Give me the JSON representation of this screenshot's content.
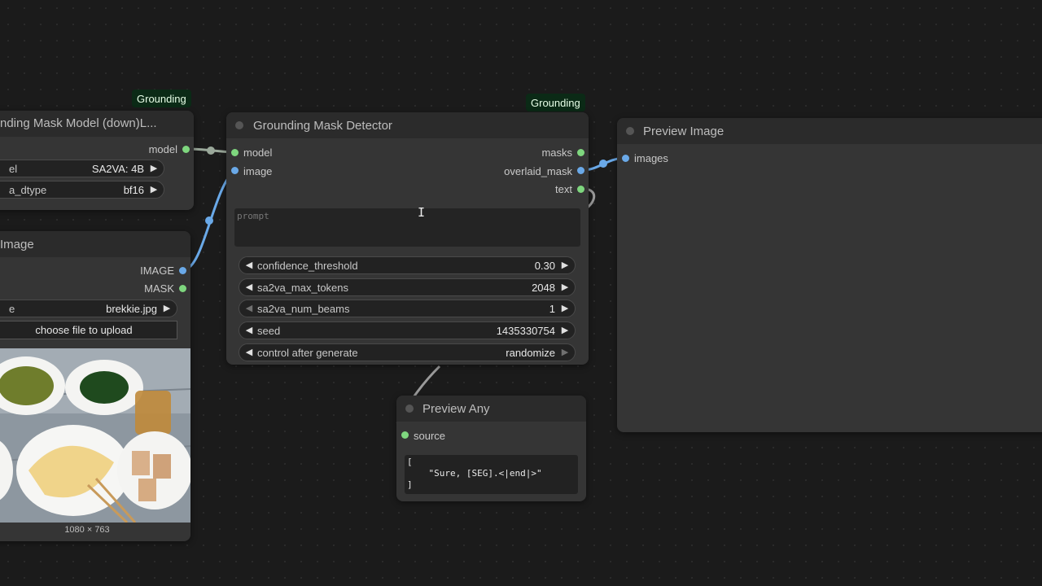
{
  "model_node": {
    "title": "nding Mask Model (down)L...",
    "badge": "Grounding",
    "output_model": "model",
    "widgets": [
      {
        "name": "el",
        "value": "SA2VA: 4B"
      },
      {
        "name": "a_dtype",
        "value": "bf16"
      }
    ]
  },
  "load_image_node": {
    "title": "Image",
    "outputs": [
      "IMAGE",
      "MASK"
    ],
    "file_widget": {
      "name": "e",
      "value": "brekkie.jpg"
    },
    "upload_button": "choose file to upload",
    "image_size": "1080 × 763"
  },
  "detector_node": {
    "title": "Grounding Mask Detector",
    "badge": "Grounding",
    "inputs": [
      "model",
      "image"
    ],
    "outputs": [
      "masks",
      "overlaid_mask",
      "text"
    ],
    "prompt_placeholder": "prompt",
    "widgets": [
      {
        "name": "confidence_threshold",
        "value": "0.30"
      },
      {
        "name": "sa2va_max_tokens",
        "value": "2048"
      },
      {
        "name": "sa2va_num_beams",
        "value": "1"
      },
      {
        "name": "seed",
        "value": "1435330754"
      },
      {
        "name": "control after generate",
        "value": "randomize"
      }
    ]
  },
  "preview_image_node": {
    "title": "Preview Image",
    "input": "images"
  },
  "preview_any_node": {
    "title": "Preview Any",
    "input": "source",
    "output_text": "[\n    \"Sure, [SEG].<|end|>\"\n]"
  },
  "colors": {
    "image_link": "#6aa9e8",
    "model_link": "#9aa89a",
    "string_link": "#8c8c8c",
    "badge_bg": "#0b2a16"
  }
}
